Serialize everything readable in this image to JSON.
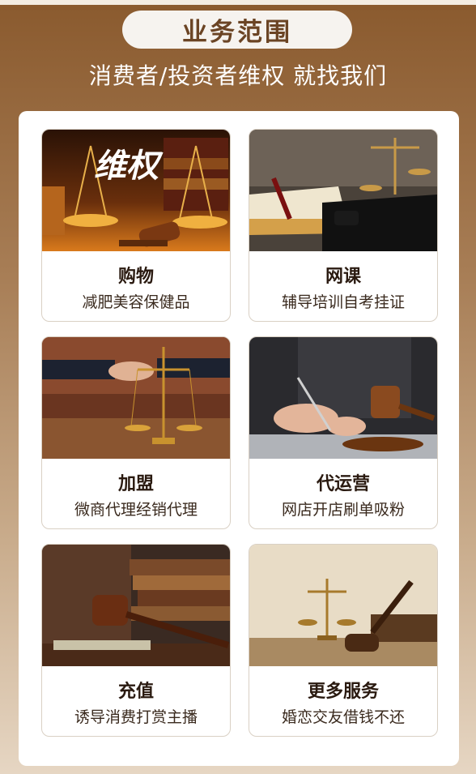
{
  "header": {
    "title": "业务范围",
    "subtitle": "消费者/投资者维权  就找我们"
  },
  "cards": [
    {
      "name": "购物",
      "desc": "减肥美容保健品",
      "image_text": "维权",
      "icon": "gavel-scales-image"
    },
    {
      "name": "网课",
      "desc": "辅导培训自考挂证",
      "icon": "books-scales-image"
    },
    {
      "name": "加盟",
      "desc": "微商代理经销代理",
      "icon": "handshake-scales-image"
    },
    {
      "name": "代运营",
      "desc": "网店开店刷单吸粉",
      "icon": "signing-gavel-image"
    },
    {
      "name": "充值",
      "desc": "诱导消费打赏主播",
      "icon": "gavel-books-image"
    },
    {
      "name": "更多服务",
      "desc": "婚恋交友借钱不还",
      "icon": "scales-gavel-image"
    }
  ]
}
